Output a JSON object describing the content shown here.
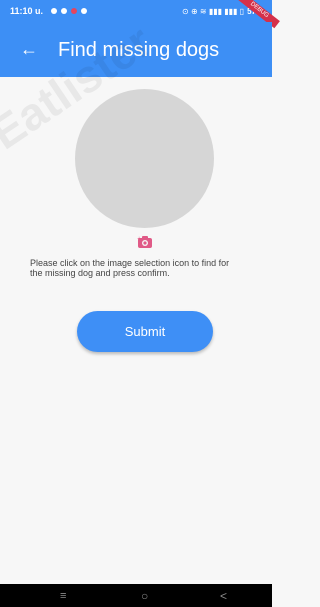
{
  "status_bar": {
    "time": "11:10 u.",
    "battery": "57",
    "ribbon": "DEBUG",
    "indicators": "⊙ ⊕ ≋ ▮▮▮ ▮▮▮ ▯"
  },
  "app_bar": {
    "title": "Find missing dogs",
    "back_icon": "←"
  },
  "main": {
    "instruction": "Please click on the image selection icon to  find for the missing dog and press confirm.",
    "submit_label": "Submit"
  },
  "nav_bar": {
    "menu": "≡",
    "home": "○",
    "back": "<"
  },
  "colors": {
    "primary": "#3d8ff5",
    "button": "#3e8ff6",
    "placeholder": "#d6d6d6",
    "camera_icon": "#e05a87"
  },
  "icons": [
    "back-arrow-icon",
    "camera-icon",
    "menu-icon",
    "home-icon",
    "back-nav-icon"
  ]
}
